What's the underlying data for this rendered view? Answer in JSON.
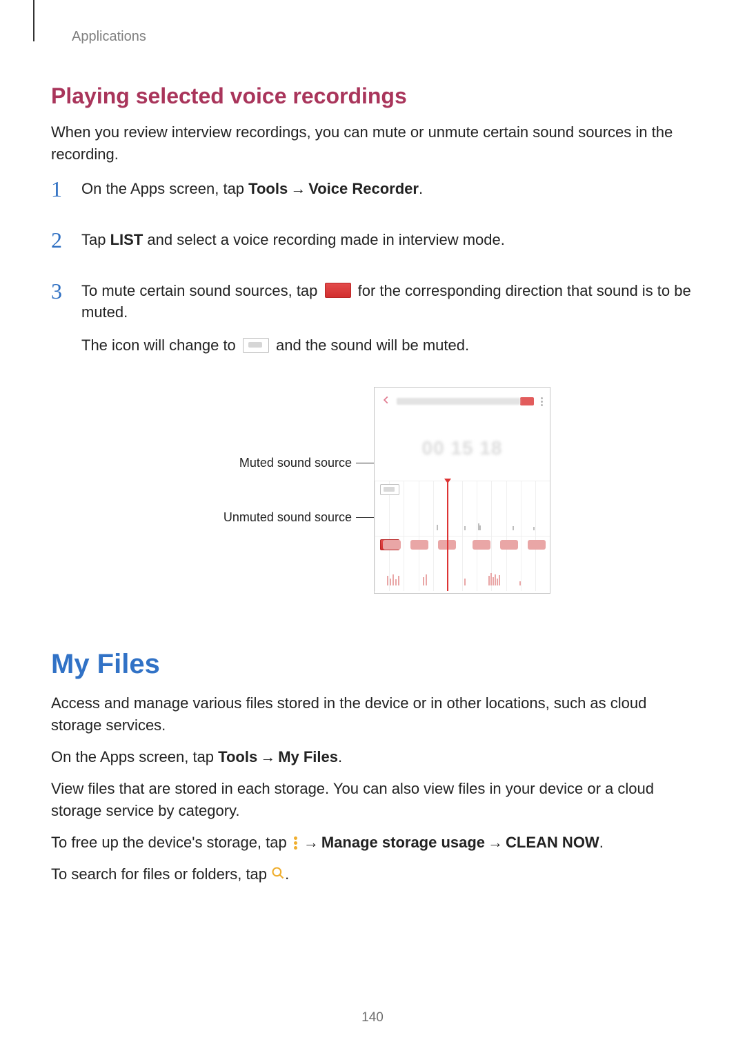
{
  "breadcrumb": "Applications",
  "section1": {
    "heading": "Playing selected voice recordings",
    "intro": "When you review interview recordings, you can mute or unmute certain sound sources in the recording.",
    "step1_a": "On the Apps screen, tap ",
    "step1_b_bold": "Tools",
    "step1_c_bold": "Voice Recorder",
    "step1_d": ".",
    "step2_a": "Tap ",
    "step2_b_bold": "LIST",
    "step2_c": " and select a voice recording made in interview mode.",
    "step3_a": "To mute certain sound sources, tap ",
    "step3_b": " for the corresponding direction that sound is to be muted.",
    "step3_c": "The icon will change to ",
    "step3_d": " and the sound will be muted."
  },
  "figure": {
    "callout_muted": "Muted sound source",
    "callout_unmuted": "Unmuted sound source",
    "time_display": "00 15 18"
  },
  "section2": {
    "heading": "My Files",
    "p1": "Access and manage various files stored in the device or in other locations, such as cloud storage services.",
    "p2_a": "On the Apps screen, tap ",
    "p2_b_bold": "Tools",
    "p2_c_bold": "My Files",
    "p2_d": ".",
    "p3": "View files that are stored in each storage. You can also view files in your device or a cloud storage service by category.",
    "p4_a": "To free up the device's storage, tap ",
    "p4_b_bold": "Manage storage usage",
    "p4_c_bold": "CLEAN NOW",
    "p4_d": ".",
    "p5_a": "To search for files or folders, tap ",
    "p5_b": "."
  },
  "arrow_glyph": "→",
  "page_number": "140"
}
